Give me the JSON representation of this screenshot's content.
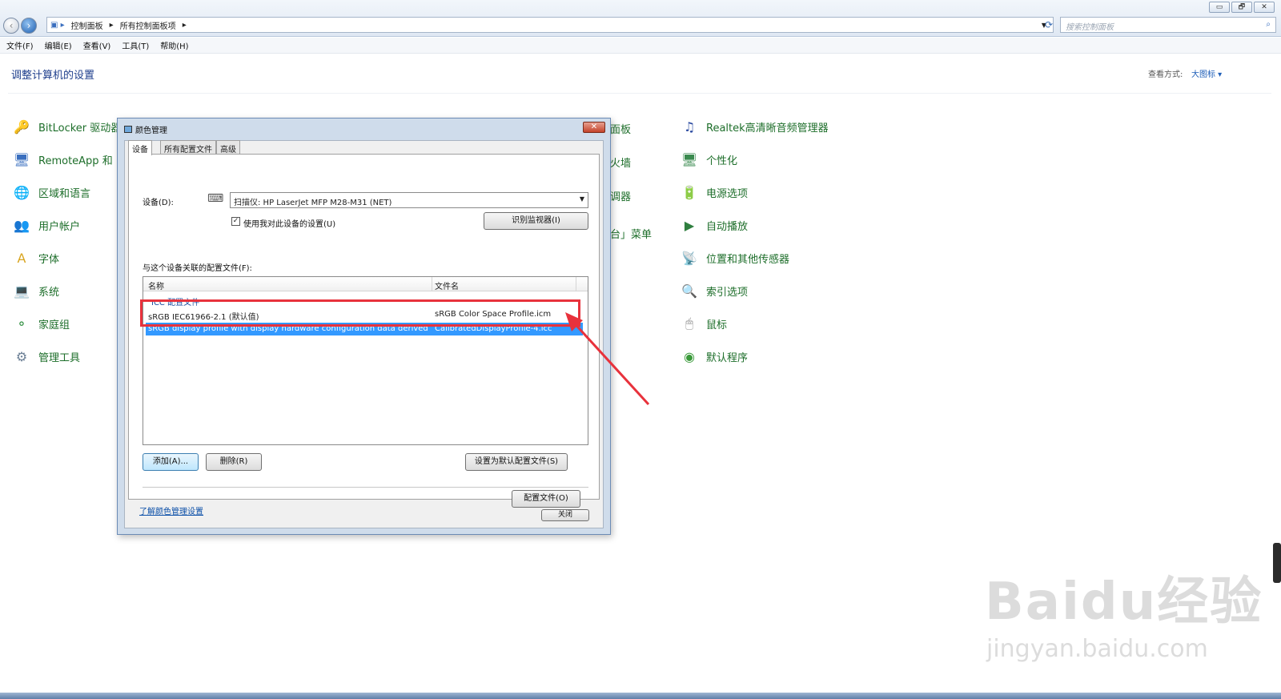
{
  "window": {
    "minimize": "▭",
    "restore": "🗗",
    "close": "✕"
  },
  "nav": {
    "back": "‹",
    "forward": "›",
    "breadcrumb": [
      "控制面板",
      "所有控制面板项"
    ],
    "search_placeholder": "搜索控制面板"
  },
  "menu": [
    "文件(F)",
    "编辑(E)",
    "查看(V)",
    "工具(T)",
    "帮助(H)"
  ],
  "header": {
    "title": "调整计算机的设置",
    "view_by_label": "查看方式:",
    "view_by_value": "大图标 ▾"
  },
  "left_items": [
    {
      "label": "BitLocker 驱动器",
      "icon": "bitlocker-icon",
      "color": "#c9a227",
      "glyph": "🔑"
    },
    {
      "label": "RemoteApp 和",
      "icon": "remoteapp-icon",
      "color": "#3a6fbf",
      "glyph": "🖥"
    },
    {
      "label": "区域和语言",
      "icon": "globe-icon",
      "color": "#2d7fd0",
      "glyph": "🌐"
    },
    {
      "label": "用户帐户",
      "icon": "users-icon",
      "color": "#4d7a3a",
      "glyph": "👥"
    },
    {
      "label": "字体",
      "icon": "font-icon",
      "color": "#d9a520",
      "glyph": "A"
    },
    {
      "label": "系统",
      "icon": "system-icon",
      "color": "#3d6db5",
      "glyph": "💻"
    },
    {
      "label": "家庭组",
      "icon": "homegroup-icon",
      "color": "#2f8f3f",
      "glyph": "⚬"
    },
    {
      "label": "管理工具",
      "icon": "admin-tools-icon",
      "color": "#6b7f95",
      "glyph": "⚙"
    }
  ],
  "middle_items": [
    "面板",
    "火墙",
    "调器",
    "台」菜单"
  ],
  "right_items": [
    {
      "label": "Realtek高清晰音频管理器",
      "icon": "realtek-icon",
      "color": "#2b4aa0",
      "glyph": "♫"
    },
    {
      "label": "个性化",
      "icon": "personalize-icon",
      "color": "#3a8a4f",
      "glyph": "🖥"
    },
    {
      "label": "电源选项",
      "icon": "power-icon",
      "color": "#4a9a3a",
      "glyph": "🔋"
    },
    {
      "label": "自动播放",
      "icon": "autoplay-icon",
      "color": "#2f7f3f",
      "glyph": "▶"
    },
    {
      "label": "位置和其他传感器",
      "icon": "sensor-icon",
      "color": "#7a8f70",
      "glyph": "📡"
    },
    {
      "label": "索引选项",
      "icon": "index-icon",
      "color": "#7a8a9a",
      "glyph": "🔍"
    },
    {
      "label": "鼠标",
      "icon": "mouse-icon",
      "color": "#8a8a8a",
      "glyph": "🖱"
    },
    {
      "label": "默认程序",
      "icon": "default-programs-icon",
      "color": "#3a9a3a",
      "glyph": "◉"
    }
  ],
  "dialog": {
    "title": "颜色管理",
    "close": "✕",
    "tabs": [
      "设备",
      "所有配置文件",
      "高级"
    ],
    "device_label": "设备(D):",
    "device_value": "扫描仪: HP LaserJet MFP M28-M31 (NET)",
    "use_my_settings": "使用我对此设备的设置(U)",
    "identify_btn": "识别监视器(I)",
    "profiles_label": "与这个设备关联的配置文件(F):",
    "col_name": "名称",
    "col_file": "文件名",
    "group": "ICC 配置文件",
    "rows": [
      {
        "name": "sRGB IEC61966-2.1 (默认值)",
        "file": "sRGB Color Space Profile.icm"
      },
      {
        "name": "sRGB display profile with display hardware configuration data derived ...",
        "file": "CalibratedDisplayProfile-4.icc"
      }
    ],
    "add_btn": "添加(A)...",
    "remove_btn": "删除(R)",
    "set_default_btn": "设置为默认配置文件(S)",
    "profiles_btn": "配置文件(O)",
    "learn_link": "了解颜色管理设置",
    "close_btn": "关闭"
  },
  "watermark": {
    "line1": "Baidu经验",
    "line2": "jingyan.baidu.com"
  }
}
